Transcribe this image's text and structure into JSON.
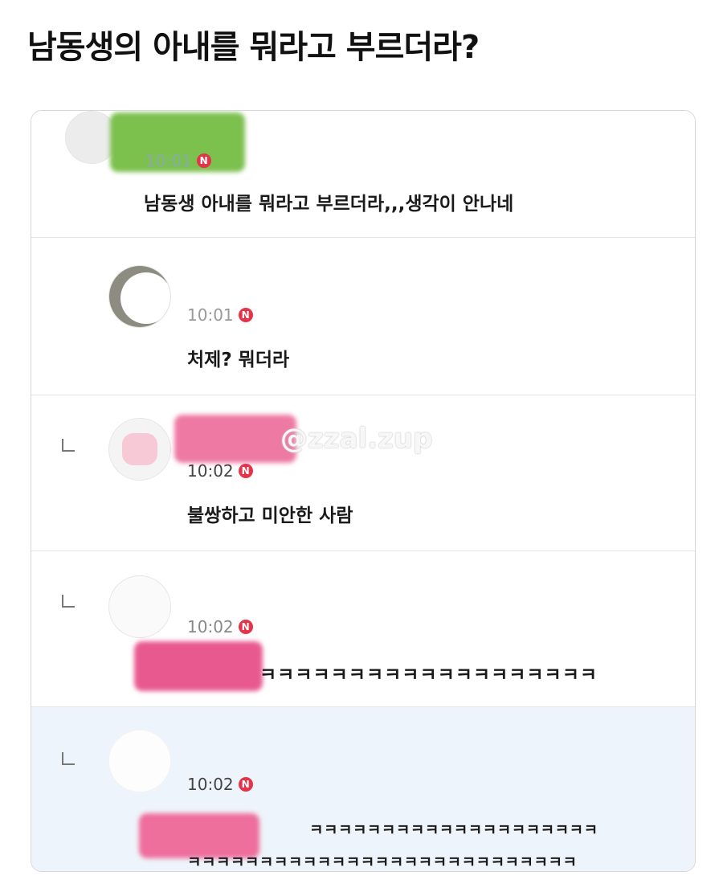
{
  "page": {
    "title": "남동생의 아내를 뭐라고 부르더라?"
  },
  "watermark": "@zzal.zup",
  "comments": [
    {
      "time": "10:01",
      "badge": "N",
      "text": "남동생 아내를 뭐라고 부르더라,,,생각이 안나네"
    },
    {
      "time": "10:01",
      "badge": "N",
      "text": "처제? 뭐더라"
    },
    {
      "time": "10:02",
      "badge": "N",
      "text": "불쌍하고 미안한 사람"
    },
    {
      "time": "10:02",
      "badge": "N",
      "text": "ㅋㅋㅋㅋㅋㅋㅋㅋㅋㅋㅋㅋㅋㅋㅋㅋㅋㅋㅋ"
    },
    {
      "time": "10:02",
      "badge": "N",
      "text_line1": "ㅋㅋㅋㅋㅋㅋㅋㅋㅋㅋㅋㅋㅋㅋㅋㅋㅋㅋㅋㅋ",
      "text_line2": "ㅋㅋㅋㅋㅋㅋㅋㅋㅋㅋㅋㅋㅋㅋㅋㅋㅋㅋㅋㅋㅋㅋㅋㅋㅋㅋㅋ"
    }
  ]
}
